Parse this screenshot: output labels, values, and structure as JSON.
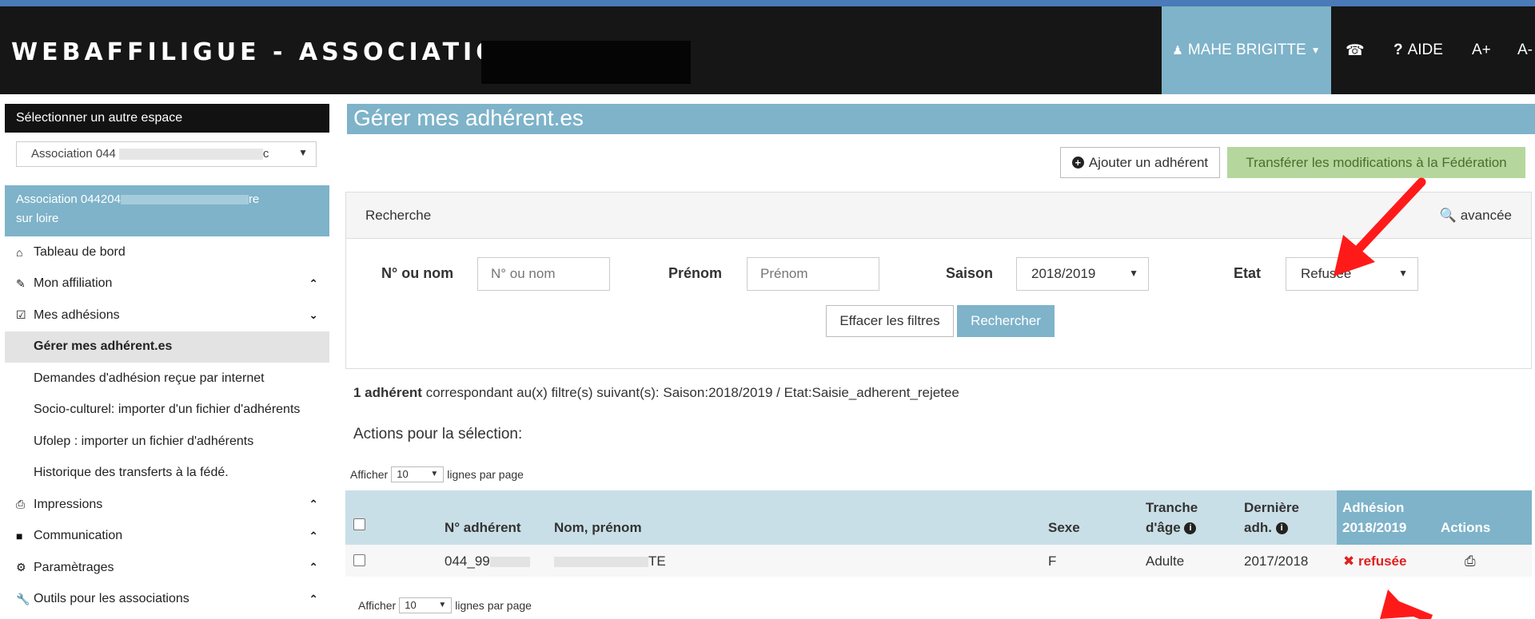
{
  "header": {
    "brand": "WEBAFFILIGUE - ASSOCIATION",
    "user": "MAHE BRIGITTE",
    "help": "AIDE",
    "font_plus": "A+",
    "font_minus": "A-"
  },
  "sidebar": {
    "select_space_title": "Sélectionner un autre espace",
    "space_select_value_start": "Association 044",
    "space_select_value_end": "c",
    "assoc_line1_start": "Association 044204",
    "assoc_line1_end": "re",
    "assoc_line2": "sur loire",
    "items": [
      {
        "label": "Tableau de bord",
        "icon": "home-icon",
        "chevron": ""
      },
      {
        "label": "Mon affiliation",
        "icon": "pencil-icon",
        "chevron": "up"
      },
      {
        "label": "Mes adhésions",
        "icon": "edit-box-icon",
        "chevron": "down"
      },
      {
        "label": "Gérer mes adhérent.es",
        "sub": true,
        "active": true
      },
      {
        "label": "Demandes d'adhésion reçue par internet",
        "sub": true
      },
      {
        "label": "Socio-culturel: importer d'un fichier d'adhérents",
        "sub": true
      },
      {
        "label": "Ufolep : importer un fichier d'adhérents",
        "sub": true
      },
      {
        "label": "Historique des transferts à la fédé.",
        "sub": true
      },
      {
        "label": "Impressions",
        "icon": "printer-icon",
        "chevron": "up"
      },
      {
        "label": "Communication",
        "icon": "comment-icon",
        "chevron": "up"
      },
      {
        "label": "Paramètrages",
        "icon": "gear-icon",
        "chevron": "up"
      },
      {
        "label": "Outils pour les associations",
        "icon": "wrench-icon",
        "chevron": "up"
      }
    ]
  },
  "main": {
    "title": "Gérer mes adhérent.es",
    "add_button": "Ajouter un adhérent",
    "transfer_button": "Transférer les modifications à la Fédération",
    "search": {
      "title": "Recherche",
      "advanced": "avancée",
      "num_label": "N° ou nom",
      "num_placeholder": "N° ou nom",
      "firstname_label": "Prénom",
      "firstname_placeholder": "Prénom",
      "season_label": "Saison",
      "season_value": "2018/2019",
      "state_label": "Etat",
      "state_value": "Refusée",
      "clear_button": "Effacer les filtres",
      "search_button": "Rechercher"
    },
    "result_count": "1 adhérent",
    "result_text": " correspondant au(x) filtre(s) suivant(s): Saison:2018/2019 / Etat:Saisie_adherent_rejetee",
    "actions_label": "Actions pour la sélection:",
    "pager": {
      "show": "Afficher",
      "value": "10",
      "suffix": "lignes par page"
    },
    "table": {
      "headers": {
        "num": "N° adhérent",
        "name": "Nom, prénom",
        "sex": "Sexe",
        "age_line1": "Tranche",
        "age_line2": "d'âge",
        "last_line1": "Dernière",
        "last_line2": "adh.",
        "adh_line1": "Adhésion",
        "adh_line2": "2018/2019",
        "actions": "Actions"
      },
      "rows": [
        {
          "num_start": "044_99",
          "name_end": "TE",
          "sex": "F",
          "age": "Adulte",
          "last": "2017/2018",
          "status": "refusée"
        }
      ]
    }
  },
  "colors": {
    "accent": "#7eb3c9",
    "topbar": "#161616",
    "transfer_bg": "#b5d79d",
    "refused": "#e02020",
    "arrow": "#ff1a1a"
  }
}
